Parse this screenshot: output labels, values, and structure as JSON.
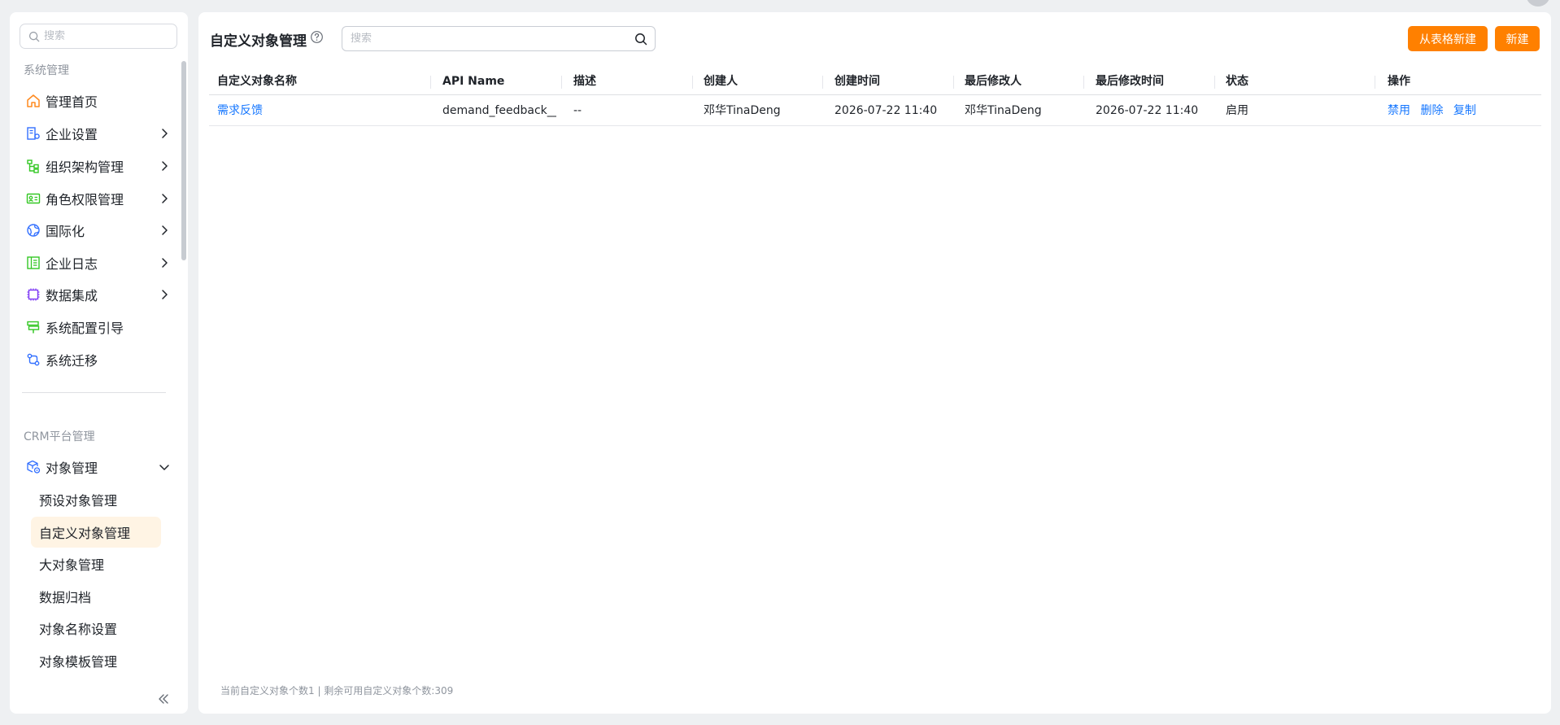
{
  "sidebar": {
    "search_placeholder": "搜索",
    "group_system": "系统管理",
    "system_items": [
      {
        "label": "管理首页",
        "icon": "home-icon"
      },
      {
        "label": "企业设置",
        "icon": "enterprise-settings-icon"
      },
      {
        "label": "组织架构管理",
        "icon": "org-structure-icon"
      },
      {
        "label": "角色权限管理",
        "icon": "role-permission-icon"
      },
      {
        "label": "国际化",
        "icon": "globe-icon"
      },
      {
        "label": "企业日志",
        "icon": "log-icon"
      },
      {
        "label": "数据集成",
        "icon": "chip-icon"
      },
      {
        "label": "系统配置引导",
        "icon": "signpost-icon"
      },
      {
        "label": "系统迁移",
        "icon": "migration-icon"
      }
    ],
    "group_crm": "CRM平台管理",
    "object_mgmt_label": "对象管理",
    "sub_items": [
      {
        "label": "预设对象管理"
      },
      {
        "label": "自定义对象管理"
      },
      {
        "label": "大对象管理"
      },
      {
        "label": "数据归档"
      },
      {
        "label": "对象名称设置"
      },
      {
        "label": "对象模板管理"
      }
    ]
  },
  "main": {
    "title": "自定义对象管理",
    "search_placeholder": "搜索",
    "btn_from_table": "从表格新建",
    "btn_new": "新建",
    "columns": [
      "自定义对象名称",
      "API Name",
      "描述",
      "创建人",
      "创建时间",
      "最后修改人",
      "最后修改时间",
      "状态",
      "操作"
    ],
    "rows": [
      {
        "name": "需求反馈",
        "api_name": "demand_feedback__c",
        "description": "--",
        "creator": "邓华TinaDeng",
        "created_at": "2026-07-22 11:40",
        "modifier": "邓华TinaDeng",
        "modified_at": "2026-07-22 11:40",
        "status": "启用",
        "actions": [
          "禁用",
          "删除",
          "复制"
        ]
      }
    ],
    "footer": "当前自定义对象个数1 | 剩余可用自定义对象个数:309"
  },
  "colors": {
    "accent": "#ff8000",
    "link": "#1677ff",
    "active_bg": "#fff4e4"
  }
}
